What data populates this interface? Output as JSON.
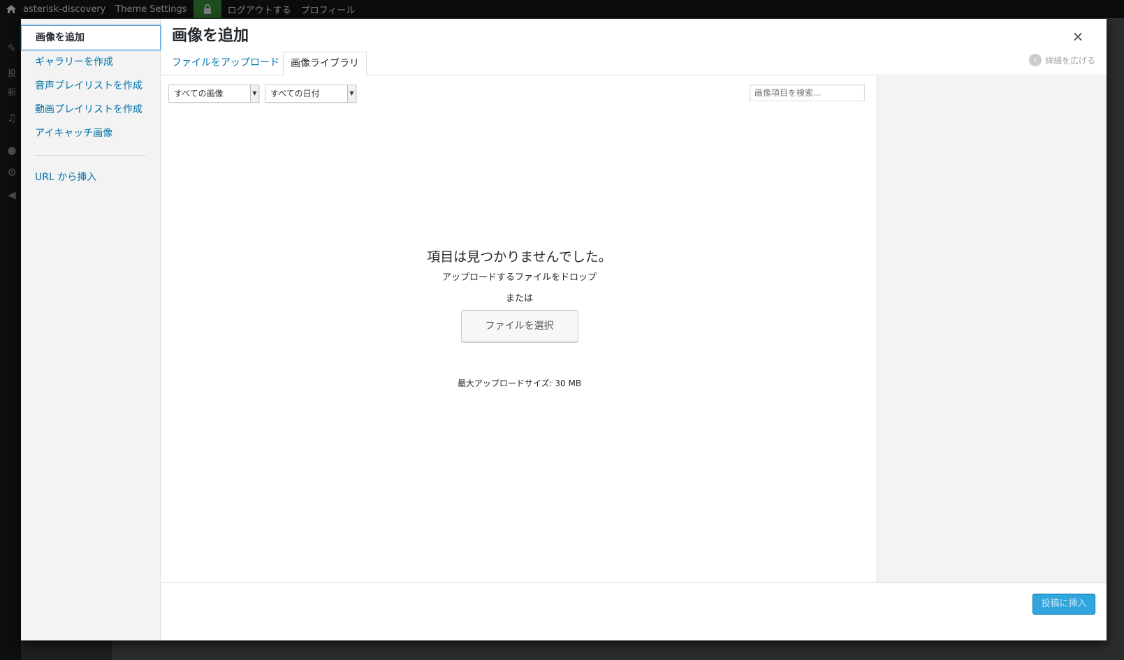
{
  "adminbar": {
    "site_name": "asterisk-discovery",
    "theme_settings": "Theme Settings",
    "logout": "ログアウトする",
    "profile": "プロフィール"
  },
  "bg_sidebar": {
    "item1": "投",
    "item2": "新"
  },
  "modal": {
    "title": "画像を追加",
    "close": "×",
    "menu": {
      "items": [
        {
          "label": "画像を追加"
        },
        {
          "label": "ギャラリーを作成"
        },
        {
          "label": "音声プレイリストを作成"
        },
        {
          "label": "動画プレイリストを作成"
        },
        {
          "label": "アイキャッチ画像"
        }
      ],
      "insert_from_url": "URL から挿入"
    },
    "tabs": {
      "upload": "ファイルをアップロード",
      "library": "画像ライブラリ"
    },
    "expand_details": "詳細を広げる",
    "toolbar": {
      "filter_type": "すべての画像",
      "filter_date": "すべての日付",
      "search_placeholder": "画像項目を検索..."
    },
    "empty": {
      "heading": "項目は見つかりませんでした。",
      "drop_text": "アップロードするファイルをドロップ",
      "or": "または",
      "select_files": "ファイルを選択",
      "max_size": "最大アップロードサイズ: 30 MB"
    },
    "footer": {
      "insert_button": "投稿に挿入"
    }
  }
}
